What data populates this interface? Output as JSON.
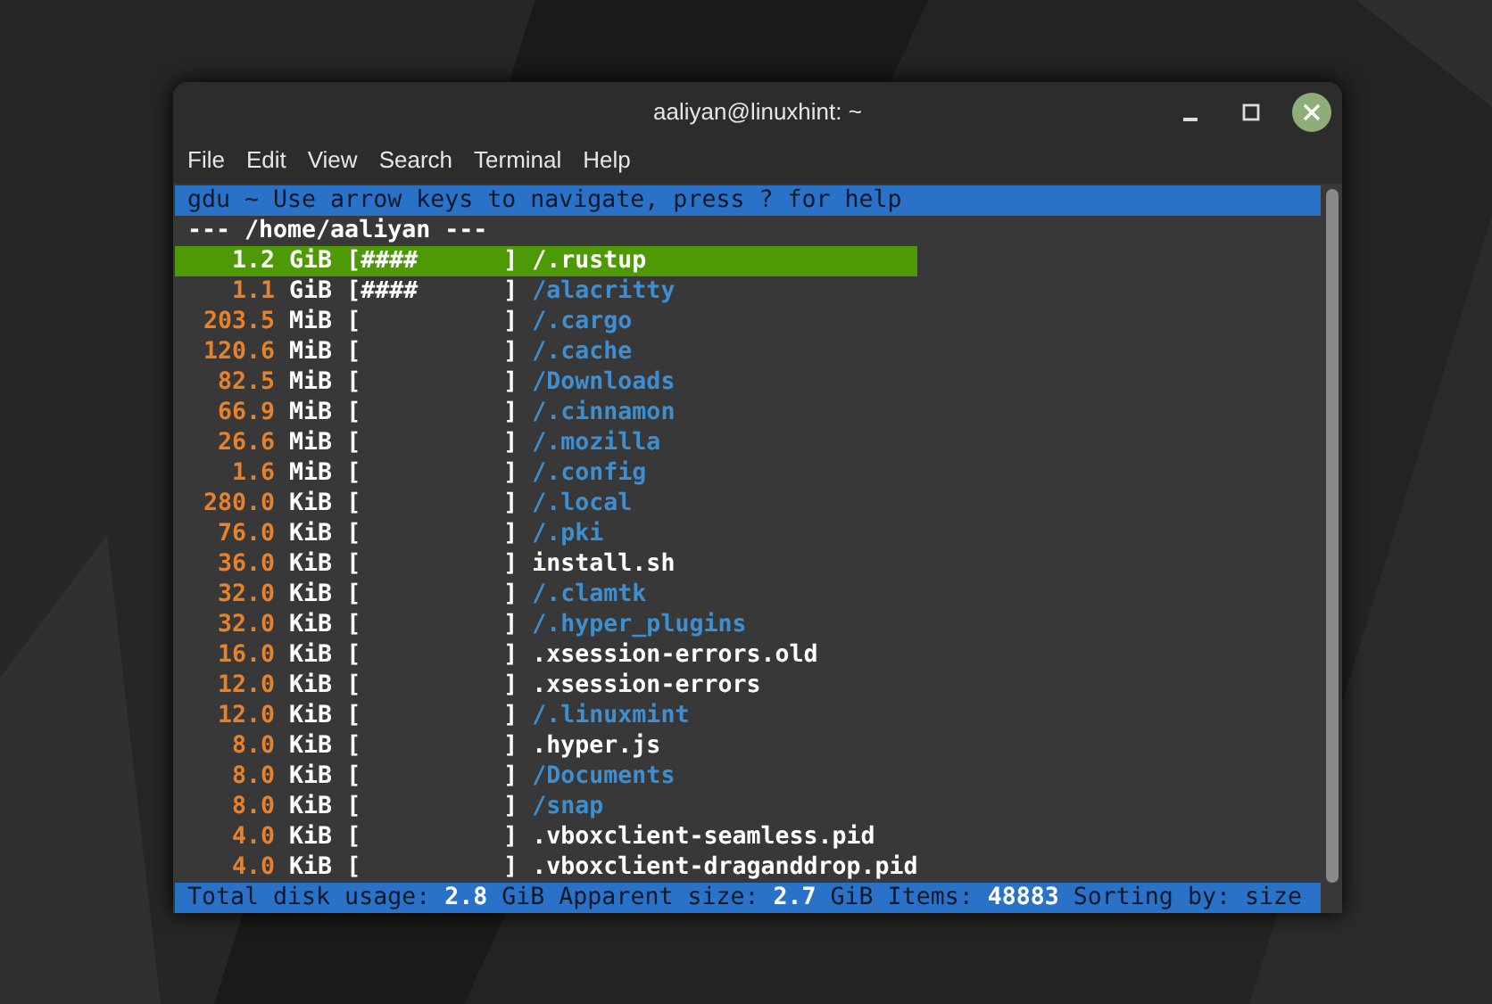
{
  "window": {
    "title": "aaliyan@linuxhint: ~"
  },
  "menu": [
    "File",
    "Edit",
    "View",
    "Search",
    "Terminal",
    "Help"
  ],
  "header": "gdu ~ Use arrow keys to navigate, press ? for help",
  "path": "--- /home/aaliyan ---",
  "rows": [
    {
      "size": "1.2",
      "unit": "GiB",
      "bar": "[####      ]",
      "name": "/.rustup",
      "kind": "dir",
      "selected": true
    },
    {
      "size": "1.1",
      "unit": "GiB",
      "bar": "[####      ]",
      "name": "/alacritty",
      "kind": "dir",
      "selected": false
    },
    {
      "size": "203.5",
      "unit": "MiB",
      "bar": "[          ]",
      "name": "/.cargo",
      "kind": "dir",
      "selected": false
    },
    {
      "size": "120.6",
      "unit": "MiB",
      "bar": "[          ]",
      "name": "/.cache",
      "kind": "dir",
      "selected": false
    },
    {
      "size": "82.5",
      "unit": "MiB",
      "bar": "[          ]",
      "name": "/Downloads",
      "kind": "dir",
      "selected": false
    },
    {
      "size": "66.9",
      "unit": "MiB",
      "bar": "[          ]",
      "name": "/.cinnamon",
      "kind": "dir",
      "selected": false
    },
    {
      "size": "26.6",
      "unit": "MiB",
      "bar": "[          ]",
      "name": "/.mozilla",
      "kind": "dir",
      "selected": false
    },
    {
      "size": "1.6",
      "unit": "MiB",
      "bar": "[          ]",
      "name": "/.config",
      "kind": "dir",
      "selected": false
    },
    {
      "size": "280.0",
      "unit": "KiB",
      "bar": "[          ]",
      "name": "/.local",
      "kind": "dir",
      "selected": false
    },
    {
      "size": "76.0",
      "unit": "KiB",
      "bar": "[          ]",
      "name": "/.pki",
      "kind": "dir",
      "selected": false
    },
    {
      "size": "36.0",
      "unit": "KiB",
      "bar": "[          ]",
      "name": "install.sh",
      "kind": "file",
      "selected": false
    },
    {
      "size": "32.0",
      "unit": "KiB",
      "bar": "[          ]",
      "name": "/.clamtk",
      "kind": "dir",
      "selected": false
    },
    {
      "size": "32.0",
      "unit": "KiB",
      "bar": "[          ]",
      "name": "/.hyper_plugins",
      "kind": "dir",
      "selected": false
    },
    {
      "size": "16.0",
      "unit": "KiB",
      "bar": "[          ]",
      "name": ".xsession-errors.old",
      "kind": "file",
      "selected": false
    },
    {
      "size": "12.0",
      "unit": "KiB",
      "bar": "[          ]",
      "name": ".xsession-errors",
      "kind": "file",
      "selected": false
    },
    {
      "size": "12.0",
      "unit": "KiB",
      "bar": "[          ]",
      "name": "/.linuxmint",
      "kind": "dir",
      "selected": false
    },
    {
      "size": "8.0",
      "unit": "KiB",
      "bar": "[          ]",
      "name": ".hyper.js",
      "kind": "file",
      "selected": false
    },
    {
      "size": "8.0",
      "unit": "KiB",
      "bar": "[          ]",
      "name": "/Documents",
      "kind": "dir",
      "selected": false
    },
    {
      "size": "8.0",
      "unit": "KiB",
      "bar": "[          ]",
      "name": "/snap",
      "kind": "dir",
      "selected": false
    },
    {
      "size": "4.0",
      "unit": "KiB",
      "bar": "[          ]",
      "name": ".vboxclient-seamless.pid",
      "kind": "file",
      "selected": false
    },
    {
      "size": "4.0",
      "unit": "KiB",
      "bar": "[          ]",
      "name": ".vboxclient-draganddrop.pid",
      "kind": "file",
      "selected": false
    }
  ],
  "status": "Total disk usage: **2.8** GiB Apparent size: **2.7** GiB Items: **48883** Sorting by: size"
}
